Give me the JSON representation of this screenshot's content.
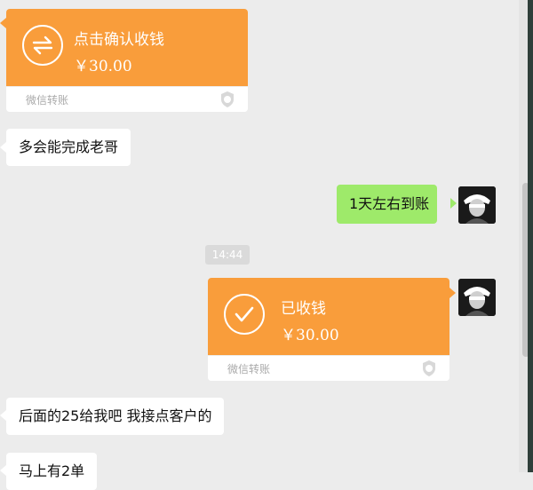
{
  "transfer_pending": {
    "title": "点击确认收钱",
    "amount": "￥30.00",
    "footer": "微信转账",
    "icon": "transfer-arrows-icon"
  },
  "messages": [
    {
      "side": "left",
      "text": "多会能完成老哥"
    },
    {
      "side": "right",
      "text": "1天左右到账"
    },
    {
      "side": "left",
      "text": "后面的25给我吧 我接点客户的"
    },
    {
      "side": "left",
      "text": "马上有2单"
    }
  ],
  "timestamp": "14:44",
  "transfer_received": {
    "title": "已收钱",
    "amount": "￥30.00",
    "footer": "微信转账",
    "icon": "checkmark-circle-icon"
  },
  "colors": {
    "transfer_orange": "#f99d3b",
    "my_bubble_green": "#9eea6a",
    "chat_background": "#ececec"
  }
}
